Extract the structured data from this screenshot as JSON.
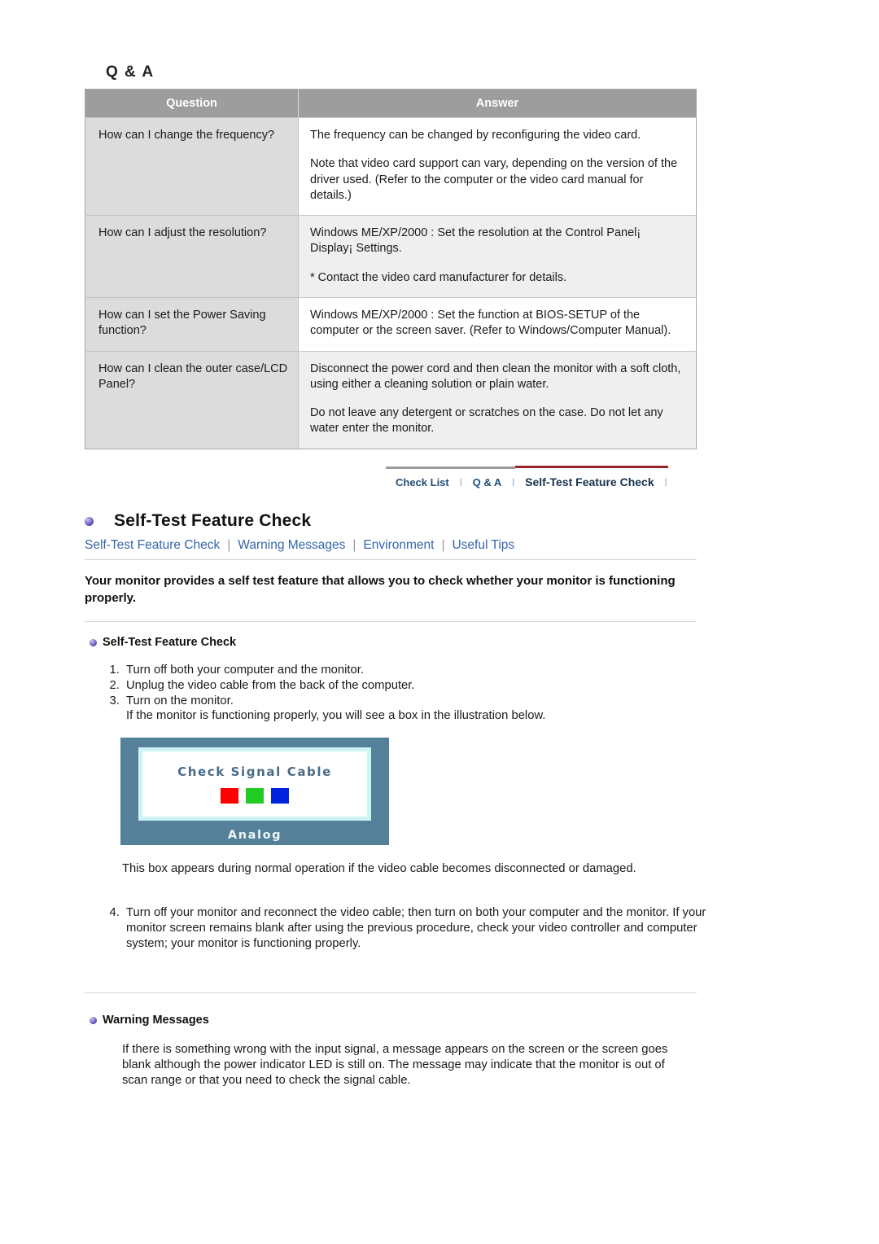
{
  "qa": {
    "heading": "Q & A",
    "columns": [
      "Question",
      "Answer"
    ],
    "rows": [
      {
        "question": "How can I change the frequency?",
        "answer": [
          "The frequency can be changed by reconfiguring the video card.",
          "Note that video card support can vary, depending on the version of the driver used. (Refer to the computer or the video card manual for details.)"
        ]
      },
      {
        "question": "How can I adjust the resolution?",
        "answer": [
          "Windows ME/XP/2000 : Set the resolution at the Control Panel¡ Display¡ Settings.",
          "* Contact the video card manufacturer for details."
        ]
      },
      {
        "question": "How can I set the Power Saving function?",
        "answer": [
          "Windows ME/XP/2000 : Set the function at BIOS-SETUP of the computer or the screen saver. (Refer to Windows/Computer Manual)."
        ]
      },
      {
        "question": "How can I clean the outer case/LCD Panel?",
        "answer": [
          "Disconnect the power cord and then clean the monitor with a soft cloth, using either a cleaning solution or plain water.",
          "Do not leave any detergent or scratches on the case. Do not let any water enter the monitor."
        ]
      }
    ]
  },
  "tabnav": {
    "check_list": "Check List",
    "qa": "Q & A",
    "self_test": "Self-Test Feature Check",
    "separator": "l",
    "inactive_line_color": "#9a9a9a",
    "active_line_color": "#99242c"
  },
  "page": {
    "title": "Self-Test Feature Check",
    "bullet_icon": "purple-sphere-bullet-icon",
    "sublinks": [
      "Self-Test Feature Check",
      "Warning Messages",
      "Environment",
      "Useful Tips"
    ],
    "sublink_separator": "|",
    "sublink_color": "#3466a8"
  },
  "intro": "Your monitor provides a self test feature that allows you to check whether your monitor is functioning properly.",
  "selftest": {
    "heading": "Self-Test Feature Check",
    "steps": [
      "Turn off both your computer and the monitor.",
      "Unplug the video cable from the back of the computer.",
      "Turn on the monitor."
    ],
    "step3_note": "If the monitor is functioning properly, you will see a box in the illustration below.",
    "after_image": "This box appears during normal operation if the video cable becomes disconnected or damaged.",
    "step4": "Turn off your monitor and reconnect the video cable; then turn on both your computer and the monitor.",
    "step4_note": "If your monitor screen remains blank after using the previous procedure, check your video controller and computer system; your monitor is functioning properly."
  },
  "illustration": {
    "message": "Check Signal Cable",
    "footer": "Analog",
    "frame_color": "#54809a",
    "inner_border_color": "#cdf4f4",
    "text_color": "#4a6b86",
    "swatches": [
      {
        "name": "red-swatch",
        "color": "#ff0000"
      },
      {
        "name": "green-swatch",
        "color": "#22cc22"
      },
      {
        "name": "blue-swatch",
        "color": "#0022dd"
      }
    ]
  },
  "warning": {
    "heading": "Warning Messages",
    "body": "If there is something wrong with the input signal, a message appears on the screen or the screen goes blank although the power indicator LED is still on. The message may indicate that the monitor is out of scan range or that you need to check the signal cable."
  }
}
